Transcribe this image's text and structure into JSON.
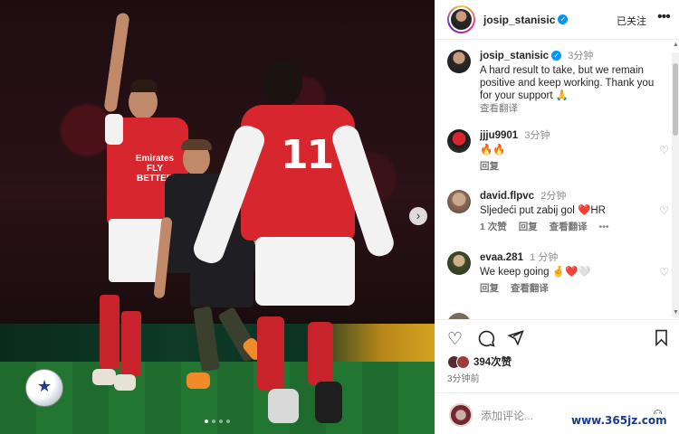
{
  "post": {
    "carousel": {
      "total_slides": 4,
      "active_index": 0
    }
  },
  "header": {
    "username": "josip_stanisic",
    "follow_state": "已关注",
    "more": "•••"
  },
  "caption": {
    "username": "josip_stanisic",
    "time": "3分钟",
    "text": "A hard result to take, but we remain positive and keep working. Thank you for your support 🙏",
    "see_translation": "查看翻译"
  },
  "comments": [
    {
      "username": "jjju9901",
      "time": "3分钟",
      "text": "🔥🔥",
      "actions": [
        "回复"
      ]
    },
    {
      "username": "david.flpvc",
      "time": "2分钟",
      "text": "Sljedeći put zabij gol ❤️HR",
      "actions": [
        "1 次赞",
        "回复",
        "查看翻译"
      ],
      "more": "•••"
    },
    {
      "username": "evaa.281",
      "time": "1 分钟",
      "text": "We keep going 🤞❤️🤍",
      "actions": [
        "回复",
        "查看翻译"
      ]
    },
    {
      "username": "",
      "time": "",
      "text": ""
    }
  ],
  "bottom": {
    "likes": "394次赞",
    "time_ago": "3分钟前",
    "add_comment_placeholder": "添加评论...",
    "watermark": "www.365jz.com"
  },
  "colors": {
    "verified": "#0095f6",
    "arsenal_red": "#d7262e",
    "link_gray": "#737373"
  },
  "icons": {
    "like": "heart-outline",
    "comment": "speech-bubble",
    "share": "paper-plane",
    "save": "bookmark",
    "next": "chevron-right",
    "emoji": "smiley"
  }
}
